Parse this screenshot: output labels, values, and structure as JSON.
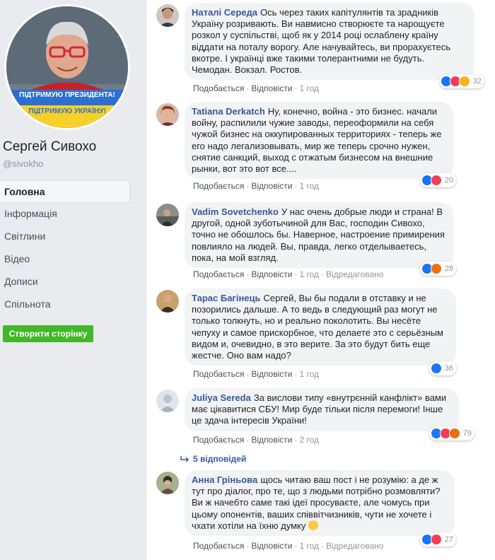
{
  "profile": {
    "name": "Сергей Сивохо",
    "handle": "@sivokho",
    "banner_line1": "ПІДТРИМУЮ ПРЕЗИДЕНТА!",
    "banner_line2": "ПІДТРИМУЮ УКРАЇНУ!"
  },
  "nav": {
    "items": [
      "Головна",
      "Інформація",
      "Світлини",
      "Відео",
      "Дописи",
      "Спільнота"
    ]
  },
  "create_page_button": "Створити сторінку",
  "labels": {
    "like": "Подобається",
    "reply": "Відповісти",
    "edited": "Відредаговано",
    "sep": "·"
  },
  "comments": [
    {
      "author": "Наталі Середа",
      "text": "Ось через таких капітулянтів та зрадників Україну розривають. Ви навмисно створюєте та нарощуєте розкол у суспільстві, щоб як у 2014 році ослаблену країну віддати на поталу ворогу. Але начувайтесь, ви прорахуєтесь вкотре. І українці вже такими толерантними не будуть. Чемодан. Вокзал. Ростов.",
      "time": "1 год",
      "reaction_count": "32",
      "reactions": [
        "like",
        "love",
        "haha"
      ]
    },
    {
      "author": "Tatiana Derkatch",
      "text": "Ну, конечно, война - это бизнес. начали войну, распилили чужие заводы, переоформили на себя чужой бизнес на оккупированных территориях - теперь же его надо легализовывать, мир же теперь срочно нужен, снятие санкций, выход с отжатым бизнесом на внешние рынки, вот это вот все....",
      "time": "1 год",
      "reaction_count": "20",
      "reactions": [
        "like",
        "love"
      ]
    },
    {
      "author": "Vadim Sovetchenko",
      "text": "У нас очень добрые люди и страна! В другой, одной зуботычиной для Вас, господин Сивохо, точно не обошлось бы. Наверное, настроение примирения повлияло на людей. Вы, правда, легко отделываетесь, пока, на мой взгляд.",
      "time": "1 год",
      "edited": true,
      "reaction_count": "28",
      "reactions": [
        "like",
        "angry"
      ]
    },
    {
      "author": "Тарас Багінець",
      "text": "Сергей, Вы бы подали в отставку и не позорились дальше. А то ведь в следующий раз могут не только толкнуть, но и реально поколотить. Вы несёте чепуху и самое прискорбное, что делаете это с серьёзным видом и, очевидно, в это верите. За это будут бить еще жестче. Оно вам надо?",
      "time": "1 год",
      "reaction_count": "36",
      "reactions": [
        "like"
      ]
    },
    {
      "author": "Juliya Sereda",
      "text": "За вислови типу «внутрєнній канфлікт» вами має цікавитися СБУ! Мир буде тільки після перемоги! Інше це здача інтересів України!",
      "time": "2 год",
      "reaction_count": "79",
      "reactions": [
        "like",
        "love",
        "angry"
      ],
      "replies": "5 відповідей"
    },
    {
      "author": "Анна Гріньова",
      "text": "щось читаю ваш пост і не розумію: а де ж тут про діалог, про те, що з людьми потрібно розмовляти? Ви ж начебто саме такі ідеї просуваєте, але чомусь при цьому опонентів, ваших співвітчизників, чути не хочете і чхати хотіли на їхню думку",
      "time": "1 год",
      "edited": true,
      "reaction_count": "27",
      "reactions": [
        "like",
        "love"
      ]
    }
  ],
  "colors": {
    "link": "#385898",
    "bubble": "#f2f3f5",
    "green_button": "#42b72a",
    "like": "#1877f2",
    "love": "#f33e58",
    "haha": "#f7b125",
    "angry": "#e9710f"
  }
}
